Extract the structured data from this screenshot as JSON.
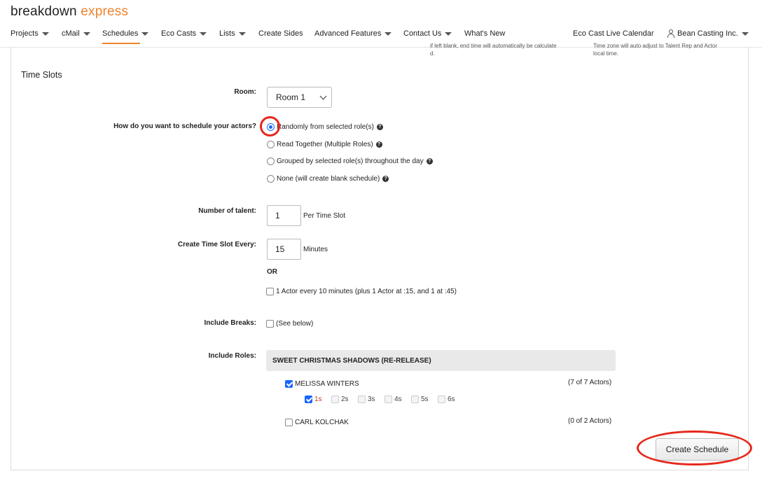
{
  "logo": {
    "part1": "breakdown",
    "part2": "express"
  },
  "nav": [
    {
      "label": "Projects",
      "dropdown": true
    },
    {
      "label": "cMail",
      "dropdown": true
    },
    {
      "label": "Schedules",
      "dropdown": true,
      "active": true
    },
    {
      "label": "Eco Casts",
      "dropdown": true
    },
    {
      "label": "Lists",
      "dropdown": true
    },
    {
      "label": "Create Sides",
      "dropdown": false
    },
    {
      "label": "Advanced Features",
      "dropdown": true
    },
    {
      "label": "Contact Us",
      "dropdown": true
    },
    {
      "label": "What's New",
      "dropdown": false
    },
    {
      "label": "Eco Cast Live Calendar",
      "dropdown": false
    },
    {
      "label": "Bean Casting Inc.",
      "dropdown": true
    }
  ],
  "clipped": {
    "left_line1": "if left blank, end time will automatically be calculate",
    "left_line2": "d.",
    "right_line1": "Time zone will auto adjust to Talent Rep and Actor",
    "right_line2": "local time."
  },
  "section_title": "Time Slots",
  "room": {
    "label": "Room:",
    "value": "Room 1"
  },
  "schedule_method": {
    "label": "How do you want to schedule your actors?",
    "options": [
      {
        "label": "Randomly from selected role(s)",
        "selected": true
      },
      {
        "label": "Read Together (Multiple Roles)",
        "selected": false
      },
      {
        "label": "Grouped by selected role(s) throughout the day",
        "selected": false
      },
      {
        "label": "None (will create blank schedule)",
        "selected": false
      }
    ],
    "help_glyph": "?"
  },
  "talent": {
    "label": "Number of talent:",
    "value": "1",
    "suffix": "Per Time Slot"
  },
  "time_slot": {
    "label": "Create Time Slot Every:",
    "value": "15",
    "suffix": "Minutes",
    "or": "OR",
    "alt_option": "1 Actor every 10 minutes (plus 1 Actor at :15, and 1 at :45)"
  },
  "breaks": {
    "label": "Include Breaks:",
    "option": "(See below)"
  },
  "roles": {
    "label": "Include Roles:",
    "project": "SWEET CHRISTMAS SHADOWS (RE-RELEASE)",
    "items": [
      {
        "name": "MELISSA WINTERS",
        "count": "(7 of 7 Actors)",
        "checked": true,
        "subs": [
          {
            "label": "1s",
            "checked": true
          },
          {
            "label": "2s",
            "checked": false
          },
          {
            "label": "3s",
            "checked": false
          },
          {
            "label": "4s",
            "checked": false
          },
          {
            "label": "5s",
            "checked": false
          },
          {
            "label": "6s",
            "checked": false
          }
        ]
      },
      {
        "name": "CARL KOLCHAK",
        "count": "(0 of 2 Actors)",
        "checked": false
      }
    ]
  },
  "create_button": "Create Schedule",
  "colors": {
    "accent": "#f0842c",
    "highlight": "#e5281b",
    "radio": "#1a66ff"
  }
}
